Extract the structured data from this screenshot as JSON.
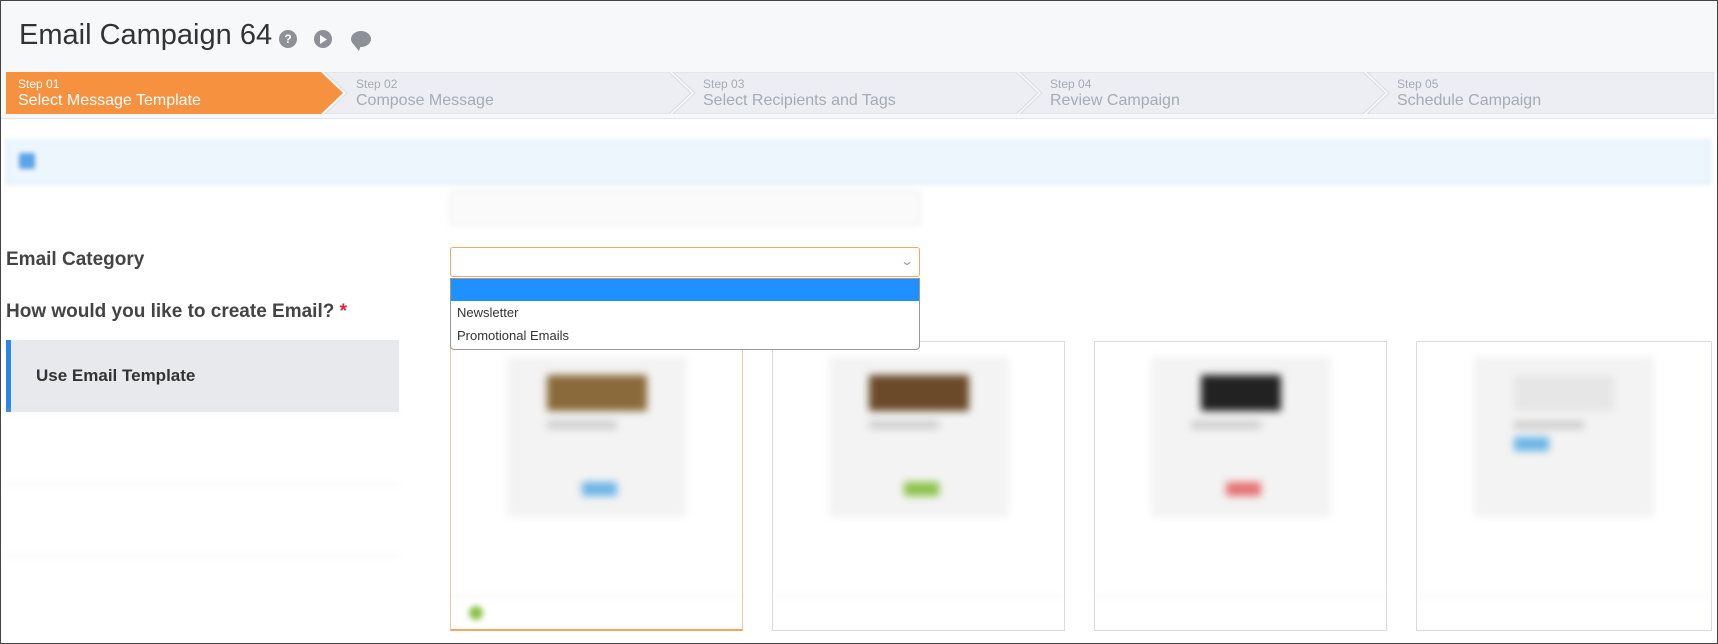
{
  "header": {
    "title": "Email Campaign 64",
    "icons": [
      "help-icon",
      "play-icon",
      "chat-icon"
    ]
  },
  "steps": [
    {
      "num": "Step 01",
      "label": "Select Message Template",
      "active": true
    },
    {
      "num": "Step 02",
      "label": "Compose Message",
      "active": false
    },
    {
      "num": "Step 03",
      "label": "Select Recipients and Tags",
      "active": false
    },
    {
      "num": "Step 04",
      "label": "Review Campaign",
      "active": false
    },
    {
      "num": "Step 05",
      "label": "Schedule Campaign",
      "active": false
    }
  ],
  "form": {
    "category_label": "Email Category",
    "category_options": [
      "",
      "Newsletter",
      "Promotional Emails"
    ],
    "how_label": "How would you like to create Email?",
    "required_mark": "*"
  },
  "side_tabs": [
    {
      "label": "Use Email Template",
      "active": true
    }
  ],
  "colors": {
    "accent_orange": "#f6913f",
    "active_blue": "#2c86e8",
    "selected_option": "#1e90ff",
    "required_red": "#d9262a"
  }
}
